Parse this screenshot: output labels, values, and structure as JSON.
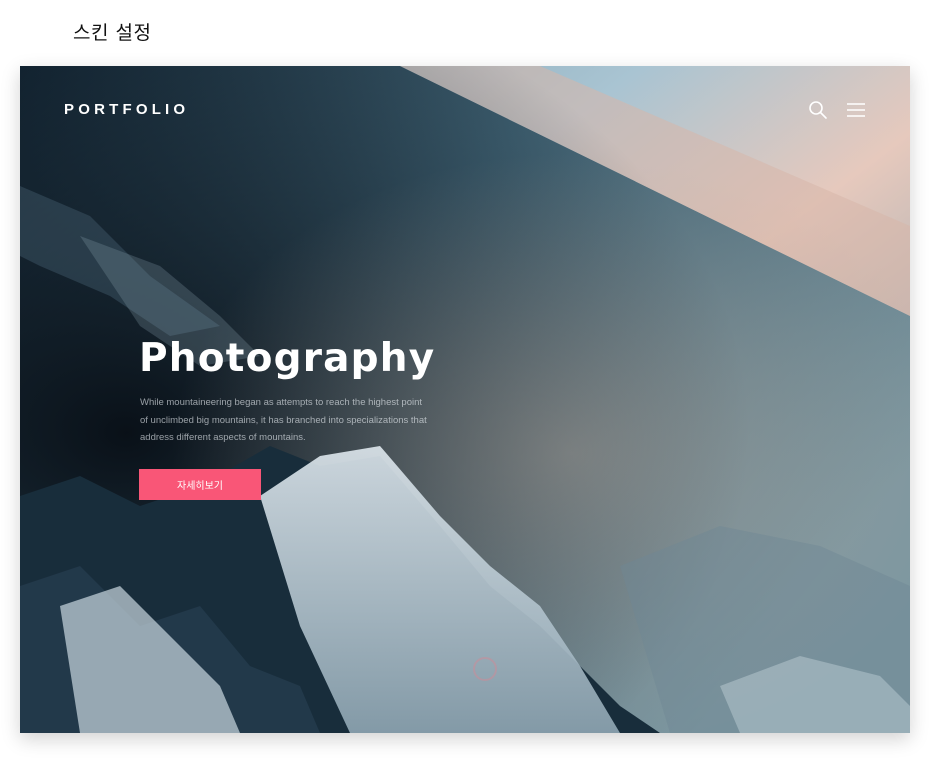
{
  "page": {
    "title": "스킨 설정"
  },
  "hero": {
    "logo": "PORTFOLIO",
    "title": "Photography",
    "description": "While mountaineering began as attempts to reach the highest point of unclimbed big mountains, it has branched into specializations that address different aspects of mountains.",
    "cta_label": "자세히보기",
    "background_image": "aerial view of snowy mountain ridges at sunset"
  },
  "nav": {
    "icons": [
      "search-icon",
      "menu-icon"
    ]
  },
  "colors": {
    "accent": "#f95677",
    "text_light": "#ffffff"
  }
}
